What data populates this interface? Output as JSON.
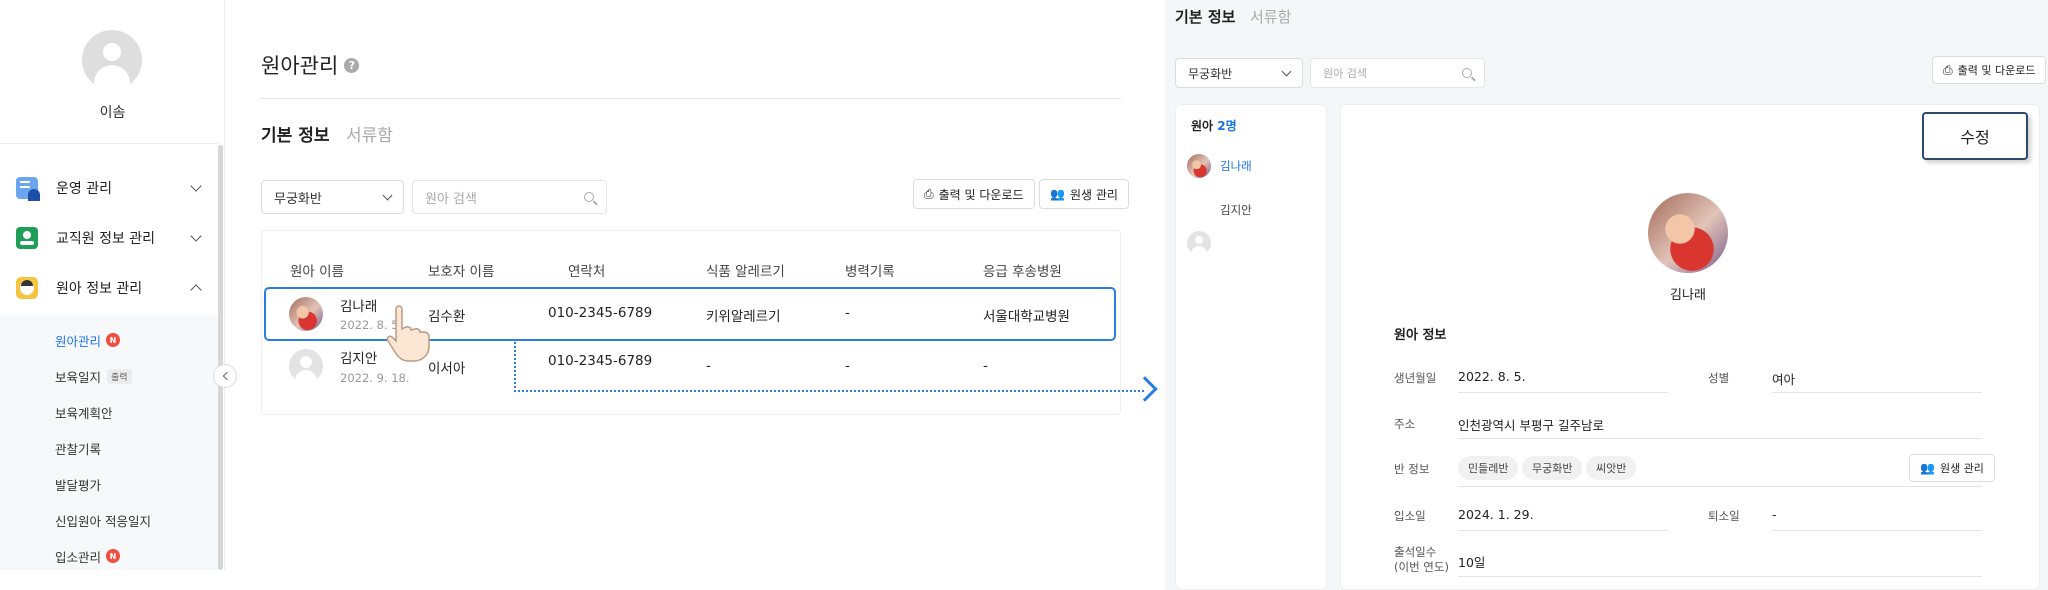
{
  "sidebar": {
    "user_name": "이솜",
    "menu": [
      {
        "label": "운영 관리"
      },
      {
        "label": "교직원 정보 관리"
      },
      {
        "label": "원아 정보 관리"
      }
    ],
    "submenu": [
      {
        "label": "원아관리",
        "badge": "N"
      },
      {
        "label": "보육일지",
        "tag": "출력"
      },
      {
        "label": "보육계획안"
      },
      {
        "label": "관찰기록"
      },
      {
        "label": "발달평가"
      },
      {
        "label": "신입원아 적응일지"
      },
      {
        "label": "입소관리",
        "badge": "N"
      }
    ]
  },
  "main": {
    "title": "원아관리",
    "help": "?",
    "tabs": [
      "기본 정보",
      "서류함"
    ],
    "class_select": "무궁화반",
    "search_placeholder": "원아 검색",
    "print_button": "출력 및 다운로드",
    "student_button": "원생 관리",
    "table": {
      "headers": [
        "원아 이름",
        "보호자 이름",
        "연락처",
        "식품 알레르기",
        "병력기록",
        "응급 후송병원"
      ],
      "rows": [
        {
          "name": "김나래",
          "dob": "2022. 8. 5.",
          "guardian": "김수환",
          "phone": "010-2345-6789",
          "allergy": "키위알레르기",
          "history": "-",
          "hospital": "서울대학교병원"
        },
        {
          "name": "김지안",
          "dob": "2022. 9. 18.",
          "guardian": "이서아",
          "phone": "010-2345-6789",
          "allergy": "-",
          "history": "-",
          "hospital": "-"
        }
      ]
    }
  },
  "detail": {
    "tabs": [
      "기본 정보",
      "서류함"
    ],
    "class_select": "무궁화반",
    "search_placeholder": "원아 검색",
    "print_button": "출력 및 다운로드",
    "list_title_prefix": "원아",
    "list_count": "2명",
    "kids": [
      "김나래",
      "김지안"
    ],
    "edit_button": "수정",
    "profile_name": "김나래",
    "section_title": "원아 정보",
    "labels": {
      "dob": "생년월일",
      "gender": "성별",
      "address": "주소",
      "class_info": "반 정보",
      "enroll": "입소일",
      "leave": "퇴소일",
      "attendance_1": "출석일수",
      "attendance_2": "(이번 연도)"
    },
    "values": {
      "dob": "2022. 8. 5.",
      "gender": "여아",
      "address": "인천광역시 부평구 길주남로",
      "enroll": "2024. 1. 29.",
      "leave": "-",
      "attendance": "10일"
    },
    "class_chips": [
      "민들레반",
      "무궁화반",
      "씨앗반"
    ],
    "student_button": "원생 관리"
  }
}
